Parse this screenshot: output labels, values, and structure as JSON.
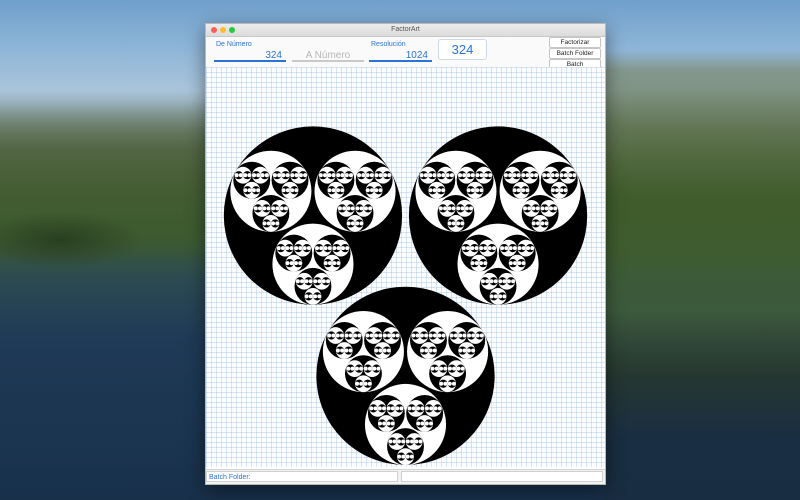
{
  "window": {
    "title": "FactorArt"
  },
  "toolbar": {
    "from_label": "De Número",
    "from_value": "324",
    "to_placeholder": "A Número",
    "resolution_label": "Resolución",
    "resolution_value": "1024",
    "current_number": "324",
    "factorize_label": "Factorizar",
    "batch_folder_label": "Batch Folder",
    "batch_label": "Batch"
  },
  "status": {
    "batch_folder_label": "Batch Folder:"
  },
  "colors": {
    "accent": "#2a73d9",
    "art_fill": "#000000",
    "art_space": "#ffffff"
  }
}
